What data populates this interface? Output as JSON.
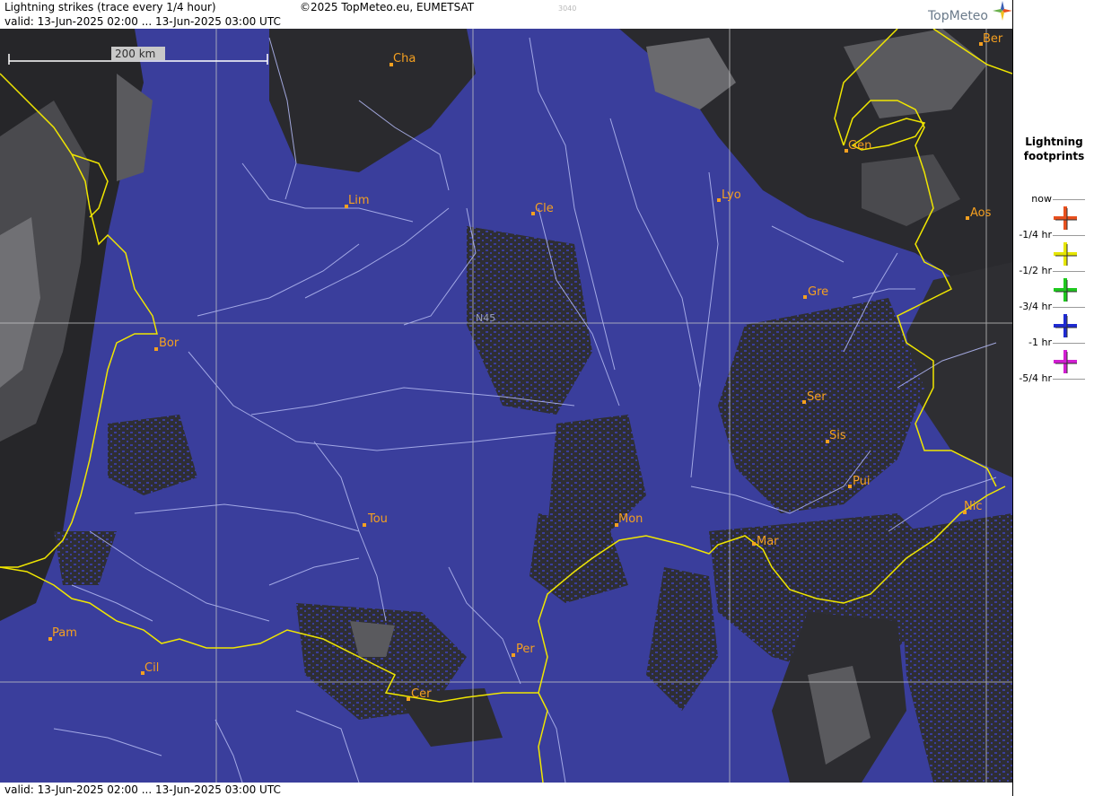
{
  "header": {
    "title": "Lightning strikes (trace every 1/4 hour)",
    "copyright": "©2025 TopMeteo.eu, EUMETSAT",
    "code": "3040",
    "valid": "valid:  13-Jun-2025 02:00 ... 13-Jun-2025 03:00 UTC",
    "logo_text": "TopMeteo",
    "logo_icon": "compass-star-icon"
  },
  "footer": {
    "valid": "valid:  13-Jun-2025 02:00 ... 13-Jun-2025 03:00 UTC"
  },
  "map": {
    "scale_label": "200 km",
    "latitude_label": "N45",
    "colors": {
      "sea_land_clear": "#3a3e9c",
      "clouds": "#2a2a2a",
      "borders": "#f0e600",
      "rivers": "#aeb4ee",
      "grid": "#c8c8c8",
      "cities": "#f5a020"
    },
    "cities": [
      {
        "name": "Ber"
      },
      {
        "name": "Cha"
      },
      {
        "name": "Gen"
      },
      {
        "name": "Lim"
      },
      {
        "name": "Cle"
      },
      {
        "name": "Lyo"
      },
      {
        "name": "Aos"
      },
      {
        "name": "Gre"
      },
      {
        "name": "Bor"
      },
      {
        "name": "Ser"
      },
      {
        "name": "Sis"
      },
      {
        "name": "Pui"
      },
      {
        "name": "Nic"
      },
      {
        "name": "Tou"
      },
      {
        "name": "Mon"
      },
      {
        "name": "Mar"
      },
      {
        "name": "Pam"
      },
      {
        "name": "Per"
      },
      {
        "name": "Cil"
      },
      {
        "name": "Cer"
      }
    ]
  },
  "legend": {
    "title": "Lightning footprints",
    "items": [
      {
        "label": "now",
        "color": "#e8501e",
        "icon": "cross-icon"
      },
      {
        "label": "-1/4 hr",
        "color": "#e6e600",
        "icon": "cross-icon"
      },
      {
        "label": "-1/2 hr",
        "color": "#1ec81e",
        "icon": "cross-icon"
      },
      {
        "label": "-3/4 hr",
        "color": "#1e2ad2",
        "icon": "cross-icon"
      },
      {
        "label": "-1 hr",
        "color": "#d21ed2",
        "icon": "cross-icon"
      },
      {
        "label": "-5/4 hr",
        "color": "",
        "icon": ""
      }
    ]
  }
}
